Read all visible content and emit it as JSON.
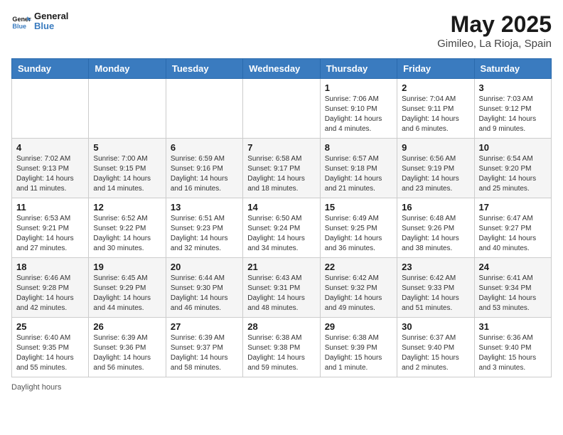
{
  "header": {
    "logo_general": "General",
    "logo_blue": "Blue",
    "title": "May 2025",
    "subtitle": "Gimileo, La Rioja, Spain"
  },
  "days_of_week": [
    "Sunday",
    "Monday",
    "Tuesday",
    "Wednesday",
    "Thursday",
    "Friday",
    "Saturday"
  ],
  "weeks": [
    [
      {
        "num": "",
        "info": ""
      },
      {
        "num": "",
        "info": ""
      },
      {
        "num": "",
        "info": ""
      },
      {
        "num": "",
        "info": ""
      },
      {
        "num": "1",
        "info": "Sunrise: 7:06 AM\nSunset: 9:10 PM\nDaylight: 14 hours\nand 4 minutes."
      },
      {
        "num": "2",
        "info": "Sunrise: 7:04 AM\nSunset: 9:11 PM\nDaylight: 14 hours\nand 6 minutes."
      },
      {
        "num": "3",
        "info": "Sunrise: 7:03 AM\nSunset: 9:12 PM\nDaylight: 14 hours\nand 9 minutes."
      }
    ],
    [
      {
        "num": "4",
        "info": "Sunrise: 7:02 AM\nSunset: 9:13 PM\nDaylight: 14 hours\nand 11 minutes."
      },
      {
        "num": "5",
        "info": "Sunrise: 7:00 AM\nSunset: 9:15 PM\nDaylight: 14 hours\nand 14 minutes."
      },
      {
        "num": "6",
        "info": "Sunrise: 6:59 AM\nSunset: 9:16 PM\nDaylight: 14 hours\nand 16 minutes."
      },
      {
        "num": "7",
        "info": "Sunrise: 6:58 AM\nSunset: 9:17 PM\nDaylight: 14 hours\nand 18 minutes."
      },
      {
        "num": "8",
        "info": "Sunrise: 6:57 AM\nSunset: 9:18 PM\nDaylight: 14 hours\nand 21 minutes."
      },
      {
        "num": "9",
        "info": "Sunrise: 6:56 AM\nSunset: 9:19 PM\nDaylight: 14 hours\nand 23 minutes."
      },
      {
        "num": "10",
        "info": "Sunrise: 6:54 AM\nSunset: 9:20 PM\nDaylight: 14 hours\nand 25 minutes."
      }
    ],
    [
      {
        "num": "11",
        "info": "Sunrise: 6:53 AM\nSunset: 9:21 PM\nDaylight: 14 hours\nand 27 minutes."
      },
      {
        "num": "12",
        "info": "Sunrise: 6:52 AM\nSunset: 9:22 PM\nDaylight: 14 hours\nand 30 minutes."
      },
      {
        "num": "13",
        "info": "Sunrise: 6:51 AM\nSunset: 9:23 PM\nDaylight: 14 hours\nand 32 minutes."
      },
      {
        "num": "14",
        "info": "Sunrise: 6:50 AM\nSunset: 9:24 PM\nDaylight: 14 hours\nand 34 minutes."
      },
      {
        "num": "15",
        "info": "Sunrise: 6:49 AM\nSunset: 9:25 PM\nDaylight: 14 hours\nand 36 minutes."
      },
      {
        "num": "16",
        "info": "Sunrise: 6:48 AM\nSunset: 9:26 PM\nDaylight: 14 hours\nand 38 minutes."
      },
      {
        "num": "17",
        "info": "Sunrise: 6:47 AM\nSunset: 9:27 PM\nDaylight: 14 hours\nand 40 minutes."
      }
    ],
    [
      {
        "num": "18",
        "info": "Sunrise: 6:46 AM\nSunset: 9:28 PM\nDaylight: 14 hours\nand 42 minutes."
      },
      {
        "num": "19",
        "info": "Sunrise: 6:45 AM\nSunset: 9:29 PM\nDaylight: 14 hours\nand 44 minutes."
      },
      {
        "num": "20",
        "info": "Sunrise: 6:44 AM\nSunset: 9:30 PM\nDaylight: 14 hours\nand 46 minutes."
      },
      {
        "num": "21",
        "info": "Sunrise: 6:43 AM\nSunset: 9:31 PM\nDaylight: 14 hours\nand 48 minutes."
      },
      {
        "num": "22",
        "info": "Sunrise: 6:42 AM\nSunset: 9:32 PM\nDaylight: 14 hours\nand 49 minutes."
      },
      {
        "num": "23",
        "info": "Sunrise: 6:42 AM\nSunset: 9:33 PM\nDaylight: 14 hours\nand 51 minutes."
      },
      {
        "num": "24",
        "info": "Sunrise: 6:41 AM\nSunset: 9:34 PM\nDaylight: 14 hours\nand 53 minutes."
      }
    ],
    [
      {
        "num": "25",
        "info": "Sunrise: 6:40 AM\nSunset: 9:35 PM\nDaylight: 14 hours\nand 55 minutes."
      },
      {
        "num": "26",
        "info": "Sunrise: 6:39 AM\nSunset: 9:36 PM\nDaylight: 14 hours\nand 56 minutes."
      },
      {
        "num": "27",
        "info": "Sunrise: 6:39 AM\nSunset: 9:37 PM\nDaylight: 14 hours\nand 58 minutes."
      },
      {
        "num": "28",
        "info": "Sunrise: 6:38 AM\nSunset: 9:38 PM\nDaylight: 14 hours\nand 59 minutes."
      },
      {
        "num": "29",
        "info": "Sunrise: 6:38 AM\nSunset: 9:39 PM\nDaylight: 15 hours\nand 1 minute."
      },
      {
        "num": "30",
        "info": "Sunrise: 6:37 AM\nSunset: 9:40 PM\nDaylight: 15 hours\nand 2 minutes."
      },
      {
        "num": "31",
        "info": "Sunrise: 6:36 AM\nSunset: 9:40 PM\nDaylight: 15 hours\nand 3 minutes."
      }
    ]
  ],
  "footer": {
    "daylight_hours": "Daylight hours"
  }
}
